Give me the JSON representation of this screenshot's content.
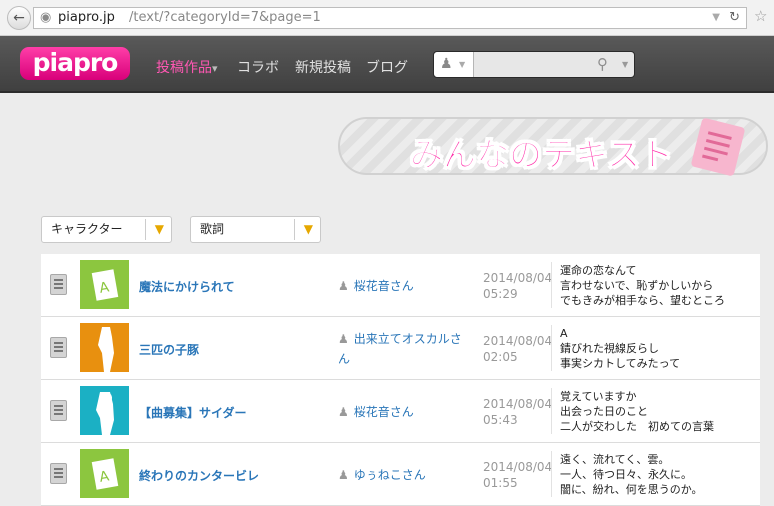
{
  "browser": {
    "url_host": "piapro.jp",
    "url_path": "/text/?categoryId=7&page=1"
  },
  "header": {
    "logo": "piapro",
    "nav": [
      "投稿作品",
      "コラボ",
      "新規投稿",
      "ブログ"
    ],
    "nav_active_arrow": "▾",
    "search_placeholder": ""
  },
  "banner": {
    "title": "みんなのテキスト"
  },
  "filters": {
    "category": "キャラクター",
    "type": "歌詞"
  },
  "works": [
    {
      "title": "魔法にかけられて",
      "author": "桜花音さん",
      "date": "2014/08/04",
      "time": "05:29",
      "excerpt": [
        "運命の恋なんて",
        "言わせないで、恥ずかしいから",
        "でもきみが相手なら、望むところ"
      ],
      "thumb": "green"
    },
    {
      "title": "三匹の子豚",
      "author": "出来立てオスカルさん",
      "date": "2014/08/04",
      "time": "02:05",
      "excerpt": [
        "A",
        "錆びれた視線反らし",
        "事実シカトしてみたって"
      ],
      "thumb": "orange"
    },
    {
      "title": "【曲募集】サイダー",
      "author": "桜花音さん",
      "date": "2014/08/04",
      "time": "05:43",
      "excerpt": [
        "覚えていますか",
        "出会った日のこと",
        "二人が交わした　初めての言葉"
      ],
      "thumb": "teal"
    },
    {
      "title": "終わりのカンタービレ",
      "author": "ゆぅねこさん",
      "date": "2014/08/04",
      "time": "01:55",
      "excerpt": [
        "遠く、流れてく、雲。",
        "一人、待つ日々、永久に。",
        "闇に、紛れ、何を思うのか。"
      ],
      "thumb": "green"
    }
  ],
  "colors": {
    "accent": "#ff2aa8",
    "link": "#2a76b8",
    "thumb_green": "#8cc63f",
    "thumb_orange": "#e8900f",
    "thumb_teal": "#1bb0c4"
  }
}
